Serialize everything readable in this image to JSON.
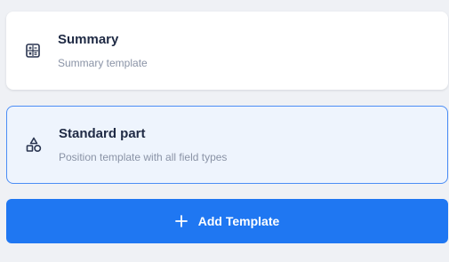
{
  "templates": [
    {
      "title": "Summary",
      "description": "Summary template",
      "icon": "calculator-icon",
      "selected": false
    },
    {
      "title": "Standard part",
      "description": "Position template with all field types",
      "icon": "shapes-icon",
      "selected": true
    }
  ],
  "add_button": {
    "label": "Add Template",
    "icon": "plus-icon"
  },
  "colors": {
    "accent": "#1f77f2",
    "selected_border": "#4b8df5",
    "selected_background": "#eef4fd",
    "title_text": "#1f2a44",
    "description_text": "#8a93a6"
  }
}
